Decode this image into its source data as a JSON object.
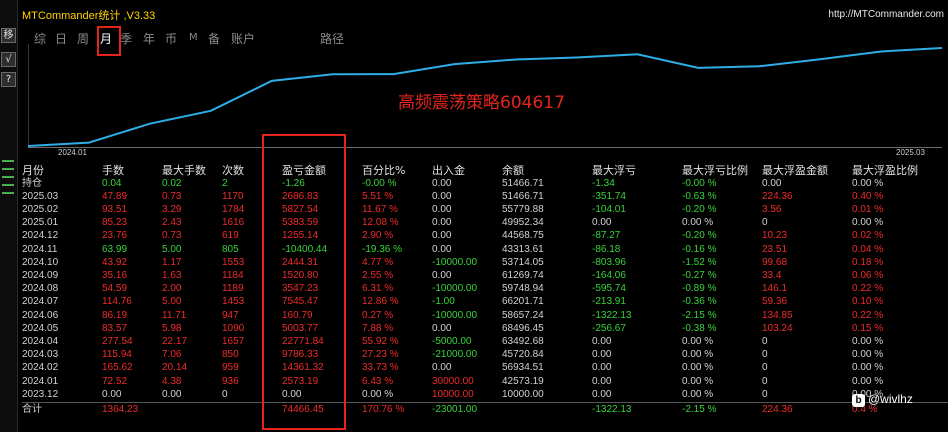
{
  "window": {
    "title": "MTCommander统计 ,V3.33",
    "url": "http://MTCommander.com"
  },
  "left_strip": {
    "buttons": [
      "移",
      "√",
      "?"
    ]
  },
  "tabs": {
    "items": [
      "综",
      "日",
      "周",
      "月",
      "季",
      "年",
      "币",
      "M",
      "备",
      "账户",
      "路径"
    ],
    "active": "月"
  },
  "chart_data": {
    "type": "line",
    "title": "",
    "annotation": "高频震荡策略604617",
    "x_start_label": "2024.01",
    "x_end_label": "2025.03",
    "x": [
      "2023.12",
      "2024.01",
      "2024.02",
      "2024.03",
      "2024.04",
      "2024.05",
      "2024.06",
      "2024.07",
      "2024.08",
      "2024.09",
      "2024.10",
      "2024.11",
      "2024.12",
      "2025.01",
      "2025.02",
      "2025.03"
    ],
    "series": [
      {
        "values": [
          0,
          2573.19,
          16934.51,
          26720.84,
          49492.68,
          54496.45,
          54657.24,
          62202.71,
          65749.94,
          67269.74,
          69714.05,
          59313.61,
          60568.75,
          65952.34,
          71779.88,
          74466.71
        ]
      }
    ],
    "line_color": "#2eaee6",
    "grid": false
  },
  "table": {
    "headers": [
      "月份",
      "手数",
      "最大手数",
      "次数",
      "盈亏金额",
      "百分比%",
      "出入金",
      "余额",
      "最大浮亏",
      "最大浮亏比例",
      "最大浮盈金额",
      "最大浮盈比例"
    ],
    "rows": [
      {
        "cells": [
          "持仓",
          "0.04",
          "0.02",
          "2",
          "-1.26",
          "-0.00 %",
          "0.00",
          "51466.71",
          "-1.34",
          "-0.00 %",
          "0.00",
          "0.00 %"
        ],
        "colors": [
          "grey",
          "green",
          "green",
          "green",
          "green",
          "green",
          "grey",
          "grey",
          "green",
          "green",
          "grey",
          "grey"
        ]
      },
      {
        "cells": [
          "2025.03",
          "47.89",
          "0.73",
          "1170",
          "2686.83",
          "5.51 %",
          "0.00",
          "51466.71",
          "-351.74",
          "-0.63 %",
          "224.36",
          "0.40 %"
        ],
        "colors": [
          "grey",
          "red",
          "red",
          "red",
          "red",
          "red",
          "grey",
          "grey",
          "green",
          "green",
          "red",
          "red"
        ]
      },
      {
        "cells": [
          "2025.02",
          "93.51",
          "3.29",
          "1784",
          "5827.54",
          "11.67 %",
          "0.00",
          "55779.88",
          "-104.01",
          "-0.20 %",
          "3.56",
          "0.01 %"
        ],
        "colors": [
          "grey",
          "red",
          "red",
          "red",
          "red",
          "red",
          "grey",
          "grey",
          "green",
          "green",
          "red",
          "red"
        ]
      },
      {
        "cells": [
          "2025.01",
          "85.23",
          "2.43",
          "1616",
          "5383.59",
          "12.08 %",
          "0.00",
          "49952.34",
          "0.00",
          "0.00 %",
          "0",
          "0.00 %"
        ],
        "colors": [
          "grey",
          "red",
          "red",
          "red",
          "red",
          "red",
          "grey",
          "grey",
          "grey",
          "grey",
          "grey",
          "grey"
        ]
      },
      {
        "cells": [
          "2024.12",
          "23.76",
          "0.73",
          "619",
          "1255.14",
          "2.90 %",
          "0.00",
          "44568.75",
          "-87.27",
          "-0.20 %",
          "10.23",
          "0.02 %"
        ],
        "colors": [
          "grey",
          "red",
          "red",
          "red",
          "red",
          "red",
          "grey",
          "grey",
          "green",
          "green",
          "red",
          "red"
        ]
      },
      {
        "cells": [
          "2024.11",
          "63.99",
          "5.00",
          "805",
          "-10400.44",
          "-19.36 %",
          "0.00",
          "43313.61",
          "-86.18",
          "-0.16 %",
          "23.51",
          "0.04 %"
        ],
        "colors": [
          "grey",
          "green",
          "green",
          "green",
          "green",
          "green",
          "grey",
          "grey",
          "green",
          "green",
          "red",
          "red"
        ]
      },
      {
        "cells": [
          "2024.10",
          "43.92",
          "1.17",
          "1553",
          "2444.31",
          "4.77 %",
          "-10000.00",
          "53714.05",
          "-803.96",
          "-1.52 %",
          "99.68",
          "0.18 %"
        ],
        "colors": [
          "grey",
          "red",
          "red",
          "red",
          "red",
          "red",
          "green",
          "grey",
          "green",
          "green",
          "red",
          "red"
        ]
      },
      {
        "cells": [
          "2024.09",
          "35.16",
          "1.63",
          "1184",
          "1520.80",
          "2.55 %",
          "0.00",
          "61269.74",
          "-164.06",
          "-0.27 %",
          "33.4",
          "0.06 %"
        ],
        "colors": [
          "grey",
          "red",
          "red",
          "red",
          "red",
          "red",
          "grey",
          "grey",
          "green",
          "green",
          "red",
          "red"
        ]
      },
      {
        "cells": [
          "2024.08",
          "54.59",
          "2.00",
          "1189",
          "3547.23",
          "6.31 %",
          "-10000.00",
          "59748.94",
          "-595.74",
          "-0.89 %",
          "146.1",
          "0.22 %"
        ],
        "colors": [
          "grey",
          "red",
          "red",
          "red",
          "red",
          "red",
          "green",
          "grey",
          "green",
          "green",
          "red",
          "red"
        ]
      },
      {
        "cells": [
          "2024.07",
          "114.76",
          "5.00",
          "1453",
          "7545.47",
          "12.86 %",
          "-1.00",
          "66201.71",
          "-213.91",
          "-0.36 %",
          "59.36",
          "0.10 %"
        ],
        "colors": [
          "grey",
          "red",
          "red",
          "red",
          "red",
          "red",
          "green",
          "grey",
          "green",
          "green",
          "red",
          "red"
        ]
      },
      {
        "cells": [
          "2024.06",
          "86.19",
          "11.71",
          "947",
          "160.79",
          "0.27 %",
          "-10000.00",
          "58657.24",
          "-1322.13",
          "-2.15 %",
          "134.85",
          "0.22 %"
        ],
        "colors": [
          "grey",
          "red",
          "red",
          "red",
          "red",
          "red",
          "green",
          "grey",
          "green",
          "green",
          "red",
          "red"
        ]
      },
      {
        "cells": [
          "2024.05",
          "83.57",
          "5.98",
          "1090",
          "5003.77",
          "7.88 %",
          "0.00",
          "68496.45",
          "-256.67",
          "-0.38 %",
          "103.24",
          "0.15 %"
        ],
        "colors": [
          "grey",
          "red",
          "red",
          "red",
          "red",
          "red",
          "grey",
          "grey",
          "green",
          "green",
          "red",
          "red"
        ]
      },
      {
        "cells": [
          "2024.04",
          "277.54",
          "22.17",
          "1657",
          "22771.84",
          "55.92 %",
          "-5000.00",
          "63492.68",
          "0.00",
          "0.00 %",
          "0",
          "0.00 %"
        ],
        "colors": [
          "grey",
          "red",
          "red",
          "red",
          "red",
          "red",
          "green",
          "grey",
          "grey",
          "grey",
          "grey",
          "grey"
        ]
      },
      {
        "cells": [
          "2024.03",
          "115.94",
          "7.06",
          "850",
          "9786.33",
          "27.23 %",
          "-21000.00",
          "45720.84",
          "0.00",
          "0.00 %",
          "0",
          "0.00 %"
        ],
        "colors": [
          "grey",
          "red",
          "red",
          "red",
          "red",
          "red",
          "green",
          "grey",
          "grey",
          "grey",
          "grey",
          "grey"
        ]
      },
      {
        "cells": [
          "2024.02",
          "165.62",
          "20.14",
          "959",
          "14361.32",
          "33.73 %",
          "0.00",
          "56934.51",
          "0.00",
          "0.00 %",
          "0",
          "0.00 %"
        ],
        "colors": [
          "grey",
          "red",
          "red",
          "red",
          "red",
          "red",
          "grey",
          "grey",
          "grey",
          "grey",
          "grey",
          "grey"
        ]
      },
      {
        "cells": [
          "2024.01",
          "72.52",
          "4.38",
          "936",
          "2573.19",
          "6.43 %",
          "30000.00",
          "42573.19",
          "0.00",
          "0.00 %",
          "0",
          "0.00 %"
        ],
        "colors": [
          "grey",
          "red",
          "red",
          "red",
          "red",
          "red",
          "red",
          "grey",
          "grey",
          "grey",
          "grey",
          "grey"
        ]
      },
      {
        "cells": [
          "2023.12",
          "0.00",
          "0.00",
          "0",
          "0.00",
          "0.00 %",
          "10000.00",
          "10000.00",
          "0.00",
          "0.00 %",
          "0",
          "0.00 %"
        ],
        "colors": [
          "grey",
          "grey",
          "grey",
          "grey",
          "grey",
          "grey",
          "red",
          "grey",
          "grey",
          "grey",
          "grey",
          "grey"
        ]
      }
    ],
    "total": {
      "cells": [
        "合计",
        "1364.23",
        "",
        "",
        "74466.45",
        "170.76 %",
        "-23001.00",
        "",
        "-1322.13",
        "-2.15 %",
        "224.36",
        "0.4 %"
      ],
      "colors": [
        "grey",
        "red",
        "grey",
        "grey",
        "red",
        "red",
        "green",
        "grey",
        "green",
        "green",
        "red",
        "red"
      ]
    }
  },
  "colors": {
    "red": "#ef2b2b",
    "green": "#38d33a",
    "grey": "#d2d2d2",
    "title_yellow": "#ffd400",
    "highlight_red": "#e5251d",
    "line_blue": "#2eaee6"
  },
  "watermark": {
    "icon": "bilibili-icon",
    "text": "@wivlhz"
  }
}
